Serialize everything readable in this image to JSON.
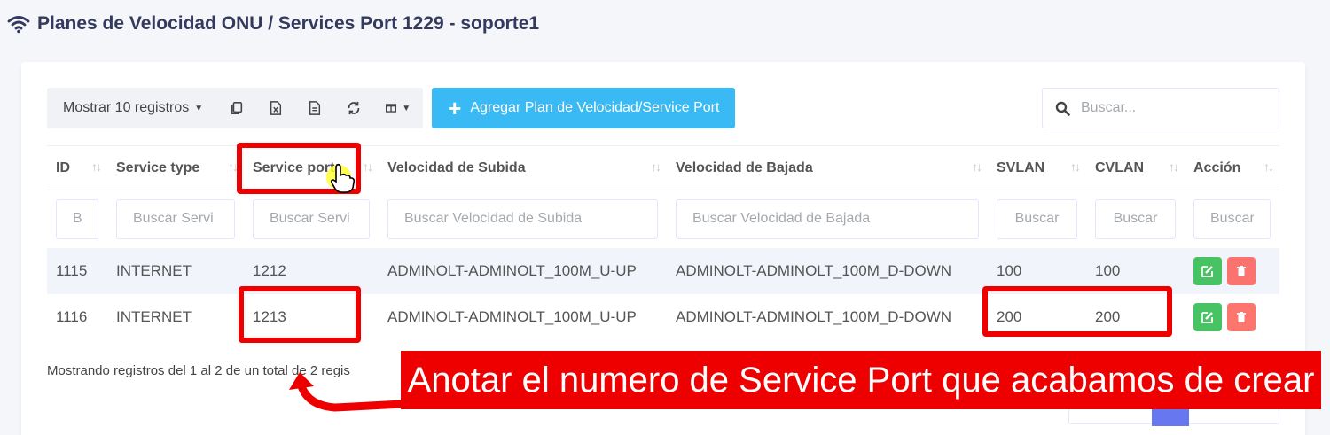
{
  "page": {
    "title": "Planes de Velocidad ONU / Services Port 1229 - soporte1"
  },
  "toolbar": {
    "show_label": "Mostrar 10 registros",
    "add_label": "Agregar Plan de Velocidad/Service Port"
  },
  "search": {
    "placeholder": "Buscar..."
  },
  "table": {
    "headers": [
      "ID",
      "Service type",
      "Service port",
      "Velocidad de Subida",
      "Velocidad de Bajada",
      "SVLAN",
      "CVLAN",
      "Acción"
    ],
    "filters": [
      "B",
      "Buscar Servi",
      "Buscar Servi",
      "Buscar Velocidad de Subida",
      "Buscar Velocidad de Bajada",
      "Buscar",
      "Buscar",
      "Buscar"
    ],
    "rows": [
      [
        "1115",
        "INTERNET",
        "1212",
        "ADMINOLT-ADMINOLT_100M_U-UP",
        "ADMINOLT-ADMINOLT_100M_D-DOWN",
        "100",
        "100"
      ],
      [
        "1116",
        "INTERNET",
        "1213",
        "ADMINOLT-ADMINOLT_100M_U-UP",
        "ADMINOLT-ADMINOLT_100M_D-DOWN",
        "200",
        "200"
      ]
    ]
  },
  "info": "Mostrando registros del 1 al 2 de un total de 2 regis",
  "annotation": {
    "text": "Anotar el numero de Service Port que acabamos de crear"
  },
  "colors": {
    "accent": "#3abaf4",
    "highlight": "#ee0000",
    "edit": "#47c363",
    "delete": "#fc544b",
    "page_active": "#6777ef"
  },
  "icons": [
    "wifi-icon",
    "copy-icon",
    "excel-icon",
    "csv-icon",
    "refresh-icon",
    "columns-icon",
    "plus-icon",
    "search-icon",
    "edit-icon",
    "trash-icon",
    "hand-cursor-icon",
    "curved-arrow-icon"
  ]
}
